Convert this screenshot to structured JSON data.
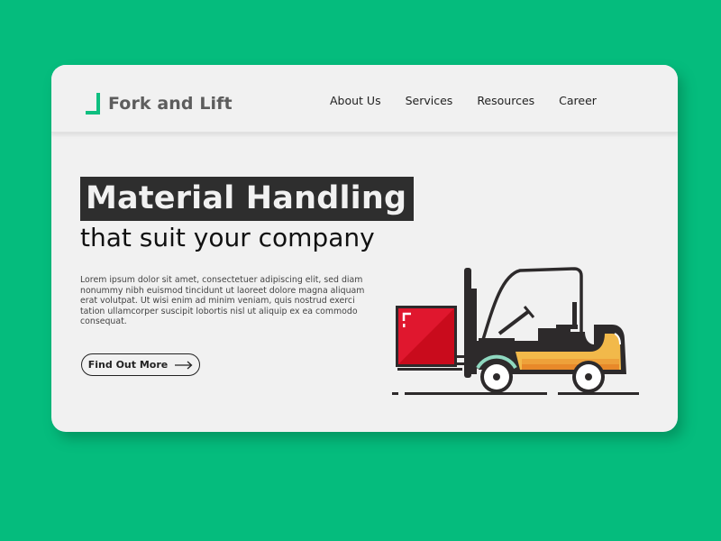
{
  "brand": {
    "name": "Fork and Lift",
    "accent_color": "#0fbf80",
    "background_color": "#05bc7d"
  },
  "nav": {
    "items": [
      {
        "label": "About Us"
      },
      {
        "label": "Services"
      },
      {
        "label": "Resources"
      },
      {
        "label": "Career"
      }
    ]
  },
  "hero": {
    "title": "Material Handling",
    "subtitle": "that suit your company",
    "body": "Lorem ipsum dolor sit amet, consectetuer adipiscing elit, sed diam nonummy nibh euismod tincidunt ut laoreet dolore magna aliquam erat volutpat. Ut wisi enim ad minim veniam, quis nostrud exerci tation ullamcorper suscipit lobortis nisl ut aliquip ex ea commodo consequat.",
    "cta_label": "Find Out More",
    "cta_icon": "arrow-right-icon"
  },
  "illustration": {
    "subject": "forklift-with-crate",
    "colors": {
      "crate": "#e0172e",
      "body": "#f2b94a",
      "body_stripe": "#e8892a",
      "outline": "#2d2a2b",
      "wheel_accent": "#8fd8c0"
    }
  }
}
